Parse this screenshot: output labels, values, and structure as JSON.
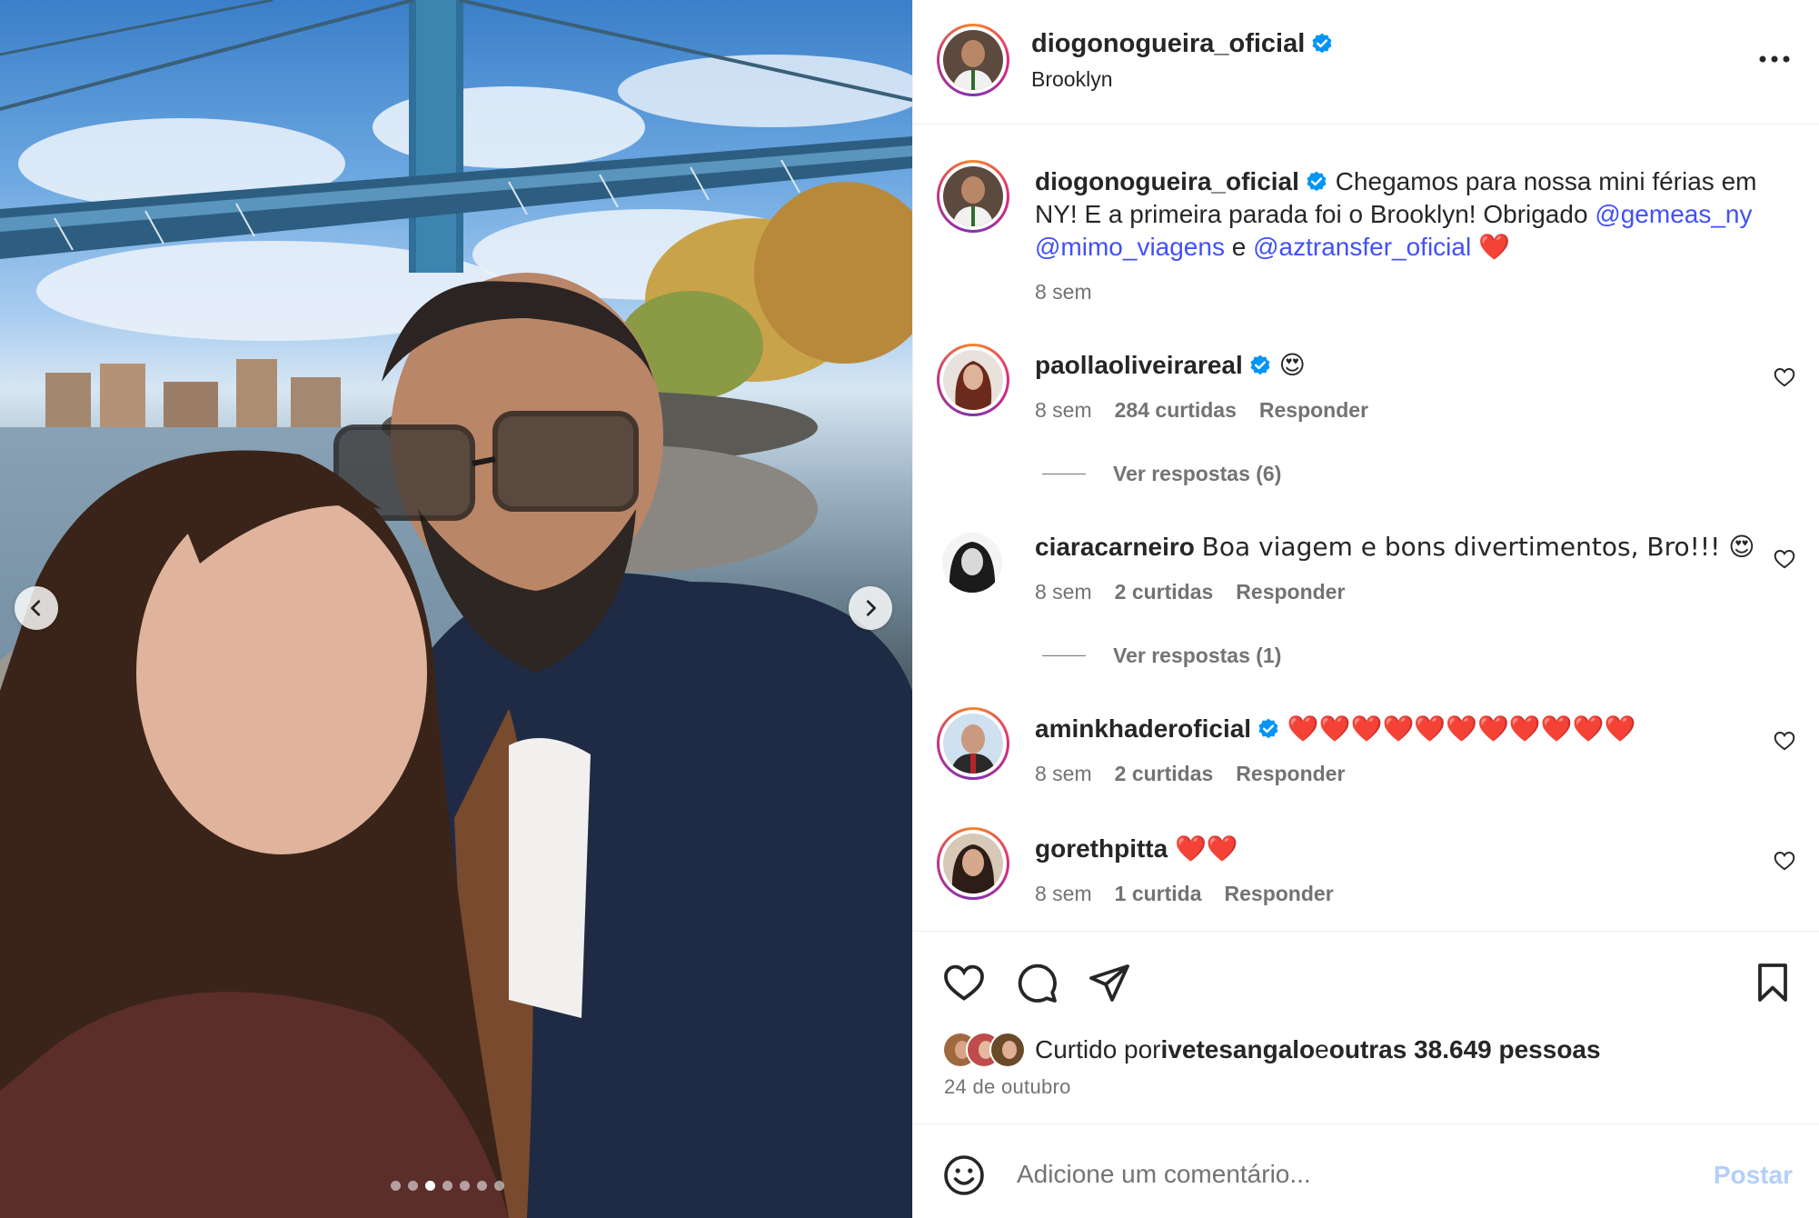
{
  "post": {
    "username": "diogonogueira_oficial",
    "location": "Brooklyn",
    "caption_text_1": "Chegamos para nossa mini férias em NY! E a primeira parada foi o Brooklyn! Obrigado ",
    "caption_mention_1": "@gemeas_ny",
    "caption_mention_2": "@mimo_viagens",
    "caption_and": " e ",
    "caption_mention_3": "@aztransfer_oficial",
    "caption_heart": "❤️",
    "caption_time": "8 sem"
  },
  "comments": [
    {
      "username": "paollaoliveirareal",
      "text": "😍",
      "time": "8 sem",
      "likes": "284 curtidas",
      "reply": "Responder",
      "view_replies": "Ver respostas (6)"
    },
    {
      "username": "ciaracarneiro",
      "text": "Boa viagem e bons divertimentos, Bro!!! 😍",
      "time": "8 sem",
      "likes": "2 curtidas",
      "reply": "Responder",
      "view_replies": "Ver respostas (1)"
    },
    {
      "username": "aminkhaderoficial",
      "text": "❤️❤️❤️❤️❤️❤️❤️❤️❤️❤️❤️",
      "time": "8 sem",
      "likes": "2 curtidas",
      "reply": "Responder"
    },
    {
      "username": "gorethpitta",
      "text": "❤️❤️",
      "time": "8 sem",
      "likes": "1 curtida",
      "reply": "Responder"
    }
  ],
  "likes_summary": {
    "prefix": "Curtido por ",
    "user": "ivetesangalo",
    "middle": " e ",
    "others": "outras 38.649 pessoas"
  },
  "date": "24 de outubro",
  "comment_box": {
    "placeholder": "Adicione um comentário...",
    "post_label": "Postar"
  },
  "carousel": {
    "total": 7,
    "active_index": 2
  },
  "icons": {
    "more": "more-options-icon",
    "like": "heart-icon",
    "comment": "comment-icon",
    "share": "share-icon",
    "save": "bookmark-icon",
    "emoji": "emoji-icon",
    "verified": "verified-badge-icon"
  },
  "colors": {
    "mention": "#4150f7",
    "verified": "#0095f6",
    "post_button_disabled": "#b3cffa",
    "meta_text": "#737373"
  }
}
